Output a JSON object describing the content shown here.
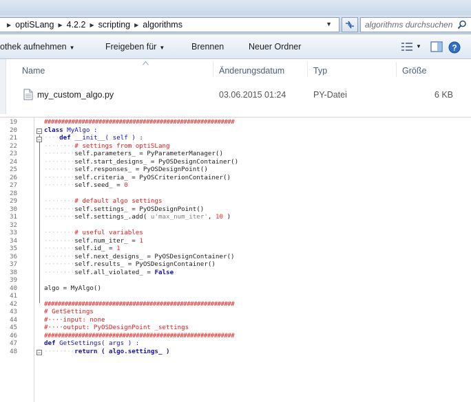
{
  "explorer": {
    "breadcrumb": [
      "optiSLang",
      "4.2.2",
      "scripting",
      "algorithms"
    ],
    "search_placeholder": "algorithms durchsuchen",
    "toolbar": {
      "library_label": "othek aufnehmen",
      "share_label": "Freigeben für",
      "burn_label": "Brennen",
      "new_folder_label": "Neuer Ordner"
    },
    "columns": [
      "Name",
      "Änderungsdatum",
      "Typ",
      "Größe"
    ],
    "files": [
      {
        "name": "my_custom_algo.py",
        "modified": "03.06.2015 01:24",
        "type": "PY-Datei",
        "size": "6 KB"
      }
    ]
  },
  "editor": {
    "lines": [
      {
        "n": "19",
        "tokens": [
          {
            "t": "########################################################",
            "c": "hash"
          }
        ]
      },
      {
        "n": "20",
        "tokens": [
          {
            "t": "class ",
            "c": "kw"
          },
          {
            "t": "MyAlgo :",
            "c": "cls"
          }
        ]
      },
      {
        "n": "21",
        "tokens": [
          {
            "t": "····",
            "c": "dots"
          },
          {
            "t": "def ",
            "c": "kw"
          },
          {
            "t": "__init__( self ) :",
            "c": "cls"
          }
        ]
      },
      {
        "n": "22",
        "tokens": [
          {
            "t": "········",
            "c": "dots"
          },
          {
            "t": "# settings from optiSLang",
            "c": "cm"
          }
        ]
      },
      {
        "n": "23",
        "tokens": [
          {
            "t": "········",
            "c": "dots"
          },
          {
            "t": "self.parameters_ = PyParameterManager()",
            "c": ""
          }
        ]
      },
      {
        "n": "24",
        "tokens": [
          {
            "t": "········",
            "c": "dots"
          },
          {
            "t": "self.start_designs_ = PyOSDesignContainer()",
            "c": ""
          }
        ]
      },
      {
        "n": "25",
        "tokens": [
          {
            "t": "········",
            "c": "dots"
          },
          {
            "t": "self.responses_ = PyOSDesignPoint()",
            "c": ""
          }
        ]
      },
      {
        "n": "26",
        "tokens": [
          {
            "t": "········",
            "c": "dots"
          },
          {
            "t": "self.criteria_ = PyOSCriterionContainer()",
            "c": ""
          }
        ]
      },
      {
        "n": "27",
        "tokens": [
          {
            "t": "········",
            "c": "dots"
          },
          {
            "t": "self.seed_ = ",
            "c": ""
          },
          {
            "t": "0",
            "c": "num"
          }
        ]
      },
      {
        "n": "28",
        "tokens": []
      },
      {
        "n": "29",
        "tokens": [
          {
            "t": "········",
            "c": "dots"
          },
          {
            "t": "# default algo settings",
            "c": "cm"
          }
        ]
      },
      {
        "n": "30",
        "tokens": [
          {
            "t": "········",
            "c": "dots"
          },
          {
            "t": "self.settings_ = PyOSDesignPoint()",
            "c": ""
          }
        ]
      },
      {
        "n": "31",
        "tokens": [
          {
            "t": "········",
            "c": "dots"
          },
          {
            "t": "self.settings_.add( ",
            "c": ""
          },
          {
            "t": "u'max_num_iter'",
            "c": "str"
          },
          {
            "t": ", ",
            "c": ""
          },
          {
            "t": "10",
            "c": "num"
          },
          {
            "t": " )",
            "c": ""
          }
        ]
      },
      {
        "n": "32",
        "tokens": []
      },
      {
        "n": "33",
        "tokens": [
          {
            "t": "········",
            "c": "dots"
          },
          {
            "t": "# useful variables",
            "c": "cm"
          }
        ]
      },
      {
        "n": "34",
        "tokens": [
          {
            "t": "········",
            "c": "dots"
          },
          {
            "t": "self.num_iter_ = ",
            "c": ""
          },
          {
            "t": "1",
            "c": "num"
          }
        ]
      },
      {
        "n": "35",
        "tokens": [
          {
            "t": "········",
            "c": "dots"
          },
          {
            "t": "self.id_ = ",
            "c": ""
          },
          {
            "t": "1",
            "c": "num"
          }
        ]
      },
      {
        "n": "36",
        "tokens": [
          {
            "t": "········",
            "c": "dots"
          },
          {
            "t": "self.next_designs_ = PyOSDesignContainer()",
            "c": ""
          }
        ]
      },
      {
        "n": "37",
        "tokens": [
          {
            "t": "········",
            "c": "dots"
          },
          {
            "t": "self.results_ = PyOSDesignContainer()",
            "c": ""
          }
        ]
      },
      {
        "n": "38",
        "tokens": [
          {
            "t": "········",
            "c": "dots"
          },
          {
            "t": "self.all_violated_ = ",
            "c": ""
          },
          {
            "t": "False",
            "c": "kw"
          }
        ]
      },
      {
        "n": "39",
        "tokens": []
      },
      {
        "n": "40",
        "tokens": [
          {
            "t": "algo = MyAlgo()",
            "c": ""
          }
        ]
      },
      {
        "n": "41",
        "tokens": []
      },
      {
        "n": "42",
        "tokens": [
          {
            "t": "########################################################",
            "c": "hash"
          }
        ]
      },
      {
        "n": "43",
        "tokens": [
          {
            "t": "# GetSettings",
            "c": "cm"
          }
        ]
      },
      {
        "n": "44",
        "tokens": [
          {
            "t": "#····input: none",
            "c": "cm"
          }
        ]
      },
      {
        "n": "45",
        "tokens": [
          {
            "t": "#····output: PyOSDesignPoint _settings",
            "c": "cm"
          }
        ]
      },
      {
        "n": "46",
        "tokens": [
          {
            "t": "########################################################",
            "c": "hash"
          }
        ]
      },
      {
        "n": "47",
        "tokens": [
          {
            "t": "def ",
            "c": "kw"
          },
          {
            "t": "GetSettings( args ) :",
            "c": "cls"
          }
        ]
      },
      {
        "n": "48",
        "tokens": [
          {
            "t": "········",
            "c": "dots"
          },
          {
            "t": "return ( algo.settings_ )",
            "c": "kw"
          }
        ]
      }
    ]
  },
  "colors": {
    "keyword": "#1010c8",
    "comment": "#e02020",
    "string": "#808080",
    "number": "#ff2020"
  }
}
